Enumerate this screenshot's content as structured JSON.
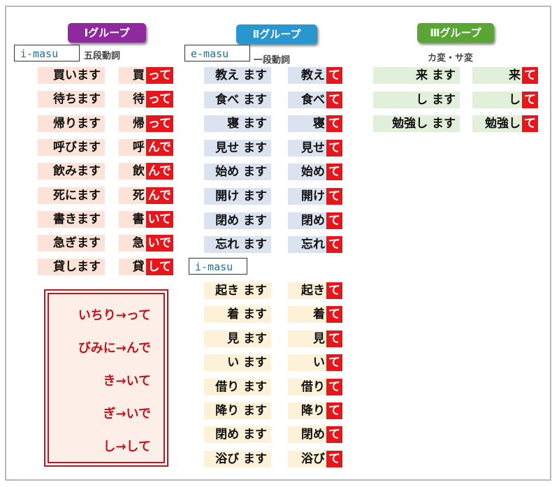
{
  "colors": {
    "group1_tag": "#8e2a9d",
    "group2_tag": "#2896cf",
    "group3_tag": "#5aa535",
    "group1_bg": "#fde3d7",
    "group2_bg": "#dbe3f0",
    "group2_imasu_bg": "#fdf1d8",
    "group3_bg": "#e2efdb",
    "suffix_bg": "#e8151b",
    "memo_text": "#c0141c"
  },
  "group1": {
    "tag": "Ⅰグループ",
    "subtitle": "五段動詞",
    "masu_label": "i-masu",
    "rows": [
      {
        "masu": "買います",
        "stem": "買",
        "suffix": "って"
      },
      {
        "masu": "待ちます",
        "stem": "待",
        "suffix": "って"
      },
      {
        "masu": "帰ります",
        "stem": "帰",
        "suffix": "って"
      },
      {
        "masu": "呼びます",
        "stem": "呼",
        "suffix": "んで"
      },
      {
        "masu": "飲みます",
        "stem": "飲",
        "suffix": "んで"
      },
      {
        "masu": "死にます",
        "stem": "死",
        "suffix": "んで"
      },
      {
        "masu": "書きます",
        "stem": "書",
        "suffix": "いて"
      },
      {
        "masu": "急ぎます",
        "stem": "急",
        "suffix": "いで"
      },
      {
        "masu": "貸します",
        "stem": "貸",
        "suffix": "して"
      }
    ],
    "memo": [
      "いちり→って",
      "びみに→んで",
      "き→いて",
      "ぎ→いで",
      "し→して"
    ]
  },
  "group2": {
    "tag": "Ⅱグループ",
    "subtitle": "一段動詞",
    "e_label": "e-masu",
    "i_label": "i-masu",
    "e_rows": [
      {
        "masu": "教え ます",
        "stem": "教え",
        "suffix": "て"
      },
      {
        "masu": "食べ ます",
        "stem": "食べ",
        "suffix": "て"
      },
      {
        "masu": "寝 ます",
        "stem": "寝",
        "suffix": "て"
      },
      {
        "masu": "見せ ます",
        "stem": "見せ",
        "suffix": "て"
      },
      {
        "masu": "始め ます",
        "stem": "始め",
        "suffix": "て"
      },
      {
        "masu": "開け ます",
        "stem": "開け",
        "suffix": "て"
      },
      {
        "masu": "閉め ます",
        "stem": "閉め",
        "suffix": "て"
      },
      {
        "masu": "忘れ ます",
        "stem": "忘れ",
        "suffix": "て"
      }
    ],
    "i_rows": [
      {
        "masu": "起き ます",
        "stem": "起き",
        "suffix": "て"
      },
      {
        "masu": "着 ます",
        "stem": "着",
        "suffix": "て"
      },
      {
        "masu": "見 ます",
        "stem": "見",
        "suffix": "て"
      },
      {
        "masu": "い ます",
        "stem": "い",
        "suffix": "て"
      },
      {
        "masu": "借り ます",
        "stem": "借り",
        "suffix": "て"
      },
      {
        "masu": "降り ます",
        "stem": "降り",
        "suffix": "て"
      },
      {
        "masu": "閉め ます",
        "stem": "閉め",
        "suffix": "て"
      },
      {
        "masu": "浴び ます",
        "stem": "浴び",
        "suffix": "て"
      }
    ]
  },
  "group3": {
    "tag": "Ⅲグループ",
    "subtitle": "カ変・サ変",
    "rows": [
      {
        "masu": "来 ます",
        "stem": "来",
        "suffix": "て"
      },
      {
        "masu": "し ます",
        "stem": "し",
        "suffix": "て"
      },
      {
        "masu": "勉強し ます",
        "stem": "勉強し",
        "suffix": "て"
      }
    ]
  }
}
